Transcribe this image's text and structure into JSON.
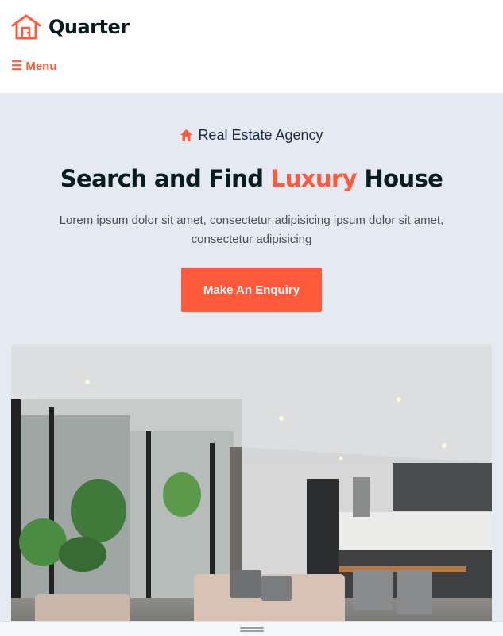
{
  "header": {
    "brand": "Quarter",
    "menu_label": "Menu",
    "logo_icon": "house-icon",
    "menu_icon": "hamburger-icon"
  },
  "hero": {
    "tagline": "Real Estate Agency",
    "tag_icon": "home-icon",
    "title_before": "Search and Find ",
    "title_accent": "Luxury",
    "title_after": " House",
    "description": "Lorem ipsum dolor sit amet, consectetur adipisicing ipsum dolor sit amet, consectetur adipisicing",
    "cta_label": "Make An Enquiry"
  },
  "colors": {
    "accent": "#ff5a3c",
    "hero_bg": "#e5e9f2",
    "dark_text": "#071c1f"
  }
}
